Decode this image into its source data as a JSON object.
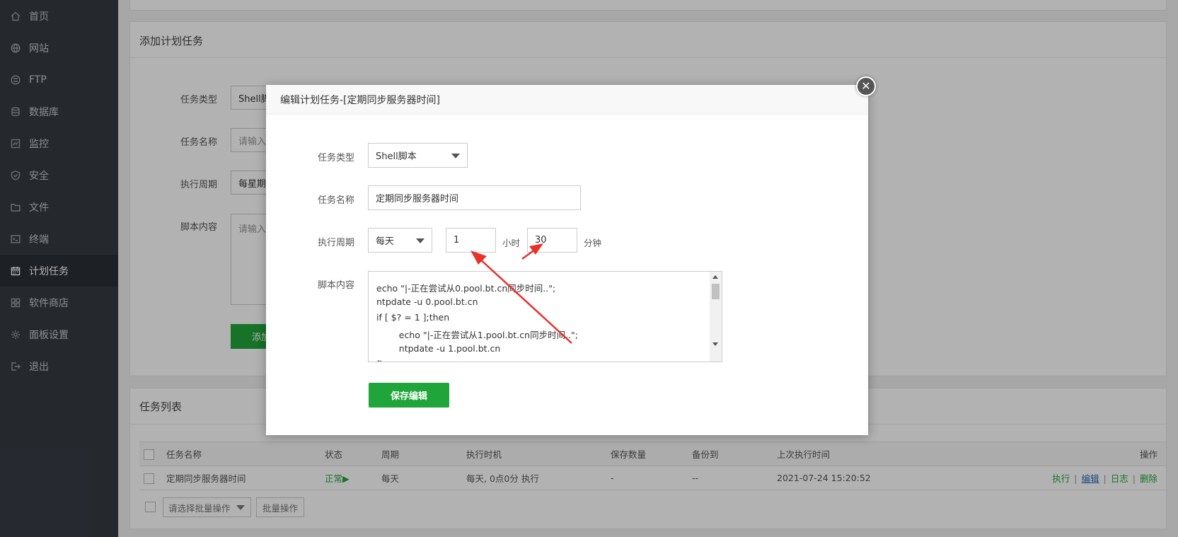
{
  "sidebar": {
    "items": [
      {
        "label": "首页",
        "icon": "home-icon"
      },
      {
        "label": "网站",
        "icon": "globe-icon"
      },
      {
        "label": "FTP",
        "icon": "ftp-icon"
      },
      {
        "label": "数据库",
        "icon": "database-icon"
      },
      {
        "label": "监控",
        "icon": "monitor-icon"
      },
      {
        "label": "安全",
        "icon": "shield-icon"
      },
      {
        "label": "文件",
        "icon": "folder-icon"
      },
      {
        "label": "终端",
        "icon": "terminal-icon"
      },
      {
        "label": "计划任务",
        "icon": "calendar-icon",
        "active": true
      },
      {
        "label": "软件商店",
        "icon": "grid-icon"
      },
      {
        "label": "面板设置",
        "icon": "gear-icon"
      },
      {
        "label": "退出",
        "icon": "logout-icon"
      }
    ]
  },
  "add_panel": {
    "title": "添加计划任务",
    "type_label": "任务类型",
    "type_value": "Shell脚本",
    "name_label": "任务名称",
    "name_placeholder": "请输入任务名称",
    "cycle_label": "执行周期",
    "cycle_value": "每星期",
    "script_label": "脚本内容",
    "script_placeholder": "请输入脚本内容",
    "add_button": "添加任务"
  },
  "task_list": {
    "title": "任务列表",
    "columns": [
      "任务名称",
      "状态",
      "周期",
      "执行时机",
      "保存数量",
      "备份到",
      "上次执行时间",
      "操作"
    ],
    "rows": [
      {
        "name": "定期同步服务器时间",
        "status": "正常▶",
        "cycle": "每天",
        "timing": "每天, 0点0分 执行",
        "save_count": "-",
        "backup_to": "--",
        "last_run": "2021-07-24 15:20:52",
        "actions": {
          "run": "执行",
          "edit": "编辑",
          "log": "日志",
          "delete": "删除"
        }
      }
    ],
    "batch_select_placeholder": "请选择批量操作",
    "batch_button": "批量操作"
  },
  "modal": {
    "title": "编辑计划任务-[定期同步服务器时间]",
    "close": "✕",
    "type_label": "任务类型",
    "type_value": "Shell脚本",
    "name_label": "任务名称",
    "name_value": "定期同步服务器时间",
    "cycle_label": "执行周期",
    "cycle_value": "每天",
    "hour_value": "1",
    "hour_unit": "小时",
    "minute_value": "30",
    "minute_unit": "分钟",
    "script_label": "脚本内容",
    "script_lines": [
      "echo \"|-正在尝试从0.pool.bt.cn同步时间..\";",
      "ntpdate -u 0.pool.bt.cn",
      "if [ $? = 1 ];then",
      "        echo \"|-正在尝试从1.pool.bt.cn同步时间..\";",
      "        ntpdate -u 1.pool.bt.cn",
      "fi"
    ],
    "save_button": "保存编辑"
  },
  "colors": {
    "accent_green": "#20a53a",
    "sidebar_bg": "#363b43",
    "arrow_red": "#e8322b"
  }
}
